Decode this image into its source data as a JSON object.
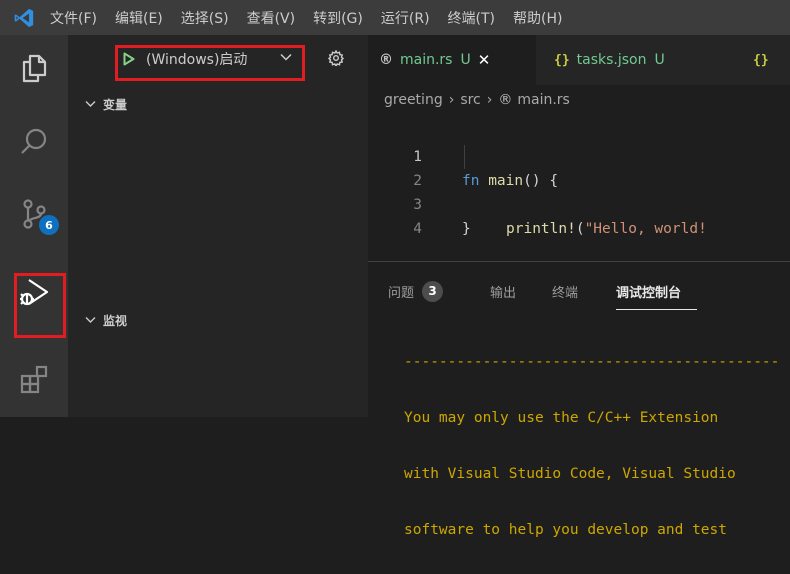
{
  "menubar": {
    "items": [
      "文件(F)",
      "编辑(E)",
      "选择(S)",
      "查看(V)",
      "转到(G)",
      "运行(R)",
      "终端(T)",
      "帮助(H)"
    ]
  },
  "activitybar": {
    "items": [
      {
        "icon": "files-icon",
        "name": "Explorer"
      },
      {
        "icon": "search-icon",
        "name": "Search"
      },
      {
        "icon": "source-control-icon",
        "name": "Source Control",
        "badge": "6"
      },
      {
        "icon": "run-debug-icon",
        "name": "Run and Debug",
        "active": true
      },
      {
        "icon": "extensions-icon",
        "name": "Extensions"
      }
    ]
  },
  "debug": {
    "config_label": "(Windows)启动",
    "variables_label": "变量",
    "watch_label": "监视"
  },
  "tabs": [
    {
      "icon": "rust-icon",
      "name": "main.rs",
      "status": "U",
      "active": true
    },
    {
      "icon": "json-braces-icon",
      "name": "tasks.json",
      "status": "U",
      "active": false
    },
    {
      "icon": "json-braces-icon",
      "name": "",
      "status": "",
      "active": false
    }
  ],
  "breadcrumb": {
    "parts": [
      "greeting",
      "src",
      "main.rs"
    ]
  },
  "code": {
    "line_numbers": [
      "1",
      "2",
      "3",
      "4"
    ],
    "line1": {
      "kw": "fn",
      "fn": "main",
      "rest": "() {"
    },
    "line2": {
      "macro": "println!",
      "open": "(",
      "str": "\"Hello, world!"
    },
    "line3": "}"
  },
  "panel": {
    "tabs": [
      {
        "label": "问题",
        "badge": "3"
      },
      {
        "label": "输出"
      },
      {
        "label": "终端"
      },
      {
        "label": "调试控制台",
        "active": true
      }
    ],
    "console_lines": [
      "-------------------------------------------",
      "You may only use the C/C++ Extension",
      "with Visual Studio Code, Visual Studio",
      "software to help you develop and test"
    ]
  },
  "colors": {
    "accent": "#0e70c0",
    "highlight_box": "#e11d21",
    "untracked_file": "#73c991",
    "console_warning": "#cca700"
  }
}
